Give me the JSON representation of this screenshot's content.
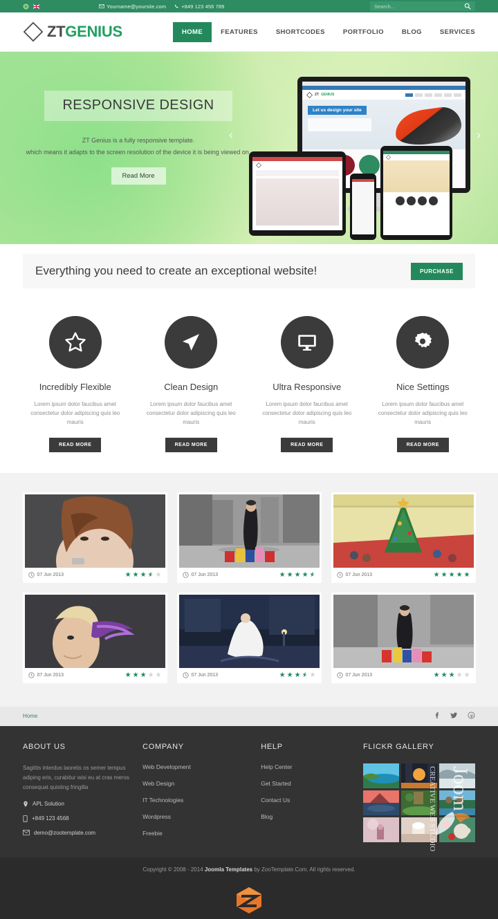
{
  "topbar": {
    "icons": [
      "joomla-icon",
      "uk-flag-icon"
    ],
    "email": "Yourname@yoursite.com",
    "phone": "+849 123 456 789",
    "search_placeholder": "Search...",
    "search_icon": "search-icon",
    "bg_color": "#2e8b62"
  },
  "header": {
    "logo": {
      "mark": "diamond-logo-icon",
      "part1": "ZT",
      "part2": "GENIUS"
    },
    "nav": [
      {
        "label": "HOME",
        "active": true
      },
      {
        "label": "FEATURES",
        "active": false
      },
      {
        "label": "SHORTCODES",
        "active": false
      },
      {
        "label": "PORTFOLIO",
        "active": false
      },
      {
        "label": "BLOG",
        "active": false
      },
      {
        "label": "SERVICES",
        "active": false
      }
    ]
  },
  "hero": {
    "title": "RESPONSIVE DESIGN",
    "subtitle_line1": "ZT Genius is a fully responsive template.",
    "subtitle_line2": "which means it adapts to the screen resolution of the device it is being viewed on.",
    "button": "Read More",
    "prev_icon": "chevron-left-icon",
    "next_icon": "chevron-right-icon",
    "device_mockup": {
      "banner": "Let us design your site",
      "logo_part1": "ZT",
      "logo_part2": "GENIUS"
    }
  },
  "cta": {
    "text": "Everything you need to create an exceptional website!",
    "button": "PURCHASE",
    "button_color": "#23895c"
  },
  "features": [
    {
      "icon": "star-icon",
      "title": "Incredibly Flexible",
      "desc": "Lorem ipsum dolor faucibus amet consectetur dolor adipiscing quis leo mauris",
      "button": "READ MORE"
    },
    {
      "icon": "paper-plane-icon",
      "title": "Clean Design",
      "desc": "Lorem ipsum dolor faucibus amet consectetur dolor adipiscing quis leo mauris",
      "button": "READ MORE"
    },
    {
      "icon": "monitor-icon",
      "title": "Ultra Responsive",
      "desc": "Lorem ipsum dolor faucibus amet consectetur dolor adipiscing quis leo mauris",
      "button": "READ MORE"
    },
    {
      "icon": "gear-icon",
      "title": "Nice Settings",
      "desc": "Lorem ipsum dolor faucibus amet consectetur dolor adipiscing quis leo mauris",
      "button": "READ MORE"
    }
  ],
  "portfolio": [
    {
      "date": "07 Jun 2013",
      "rating": 3.5,
      "subject": "fashion-portrait-brunette"
    },
    {
      "date": "07 Jun 2013",
      "rating": 4.5,
      "subject": "shopping-woman-street"
    },
    {
      "date": "07 Jun 2013",
      "rating": 5,
      "subject": "christmas-mall-illustration"
    },
    {
      "date": "07 Jun 2013",
      "rating": 3,
      "subject": "blonde-purple-smoke"
    },
    {
      "date": "07 Jun 2013",
      "rating": 3.5,
      "subject": "night-street-dancer"
    },
    {
      "date": "07 Jun 2013",
      "rating": 3,
      "subject": "shopping-bags-model"
    }
  ],
  "breadcrumb": {
    "home": "Home",
    "social": [
      {
        "icon": "facebook-icon",
        "glyph": "f"
      },
      {
        "icon": "twitter-icon",
        "glyph": "t"
      },
      {
        "icon": "pinterest-icon",
        "glyph": "p"
      }
    ]
  },
  "footer": {
    "about": {
      "title": "ABOUT US",
      "text": "Sagittis interdus laoretis os semer tempus adiping eris, curabitur wisi eu at cras meros consequat quisting fringilla",
      "address": "APL Solution",
      "phone": "+849 123 4568",
      "email": "demo@zootemplate.com",
      "address_icon": "map-pin-icon",
      "phone_icon": "mobile-icon",
      "email_icon": "envelope-icon"
    },
    "company": {
      "title": "COMPANY",
      "links": [
        "Web Development",
        "Web Design",
        "IT Technologies",
        "Wordpress",
        "Freebie"
      ]
    },
    "help": {
      "title": "HELP",
      "links": [
        "Help Center",
        "Get Started",
        "Contact Us",
        "Blog"
      ]
    },
    "flickr": {
      "title": "FLICKR GALLERY",
      "thumbs": [
        "coastline-beach",
        "city-sunset",
        "misty-lake",
        "red-mountain-sunset",
        "garden-pond",
        "statues-reflection",
        "pink-bokeh-bottle",
        "hands-cupcake",
        "red-mug-flowers"
      ]
    },
    "watermark": "JoomFox - Creative Web Studio"
  },
  "copyright": {
    "prefix": "Copyright © 2008 - 2014 ",
    "brand": "Joomla Templates",
    "suffix": " by ZooTemplate.Com. All rights reserved.",
    "logo": "zt-hex-logo-icon"
  }
}
